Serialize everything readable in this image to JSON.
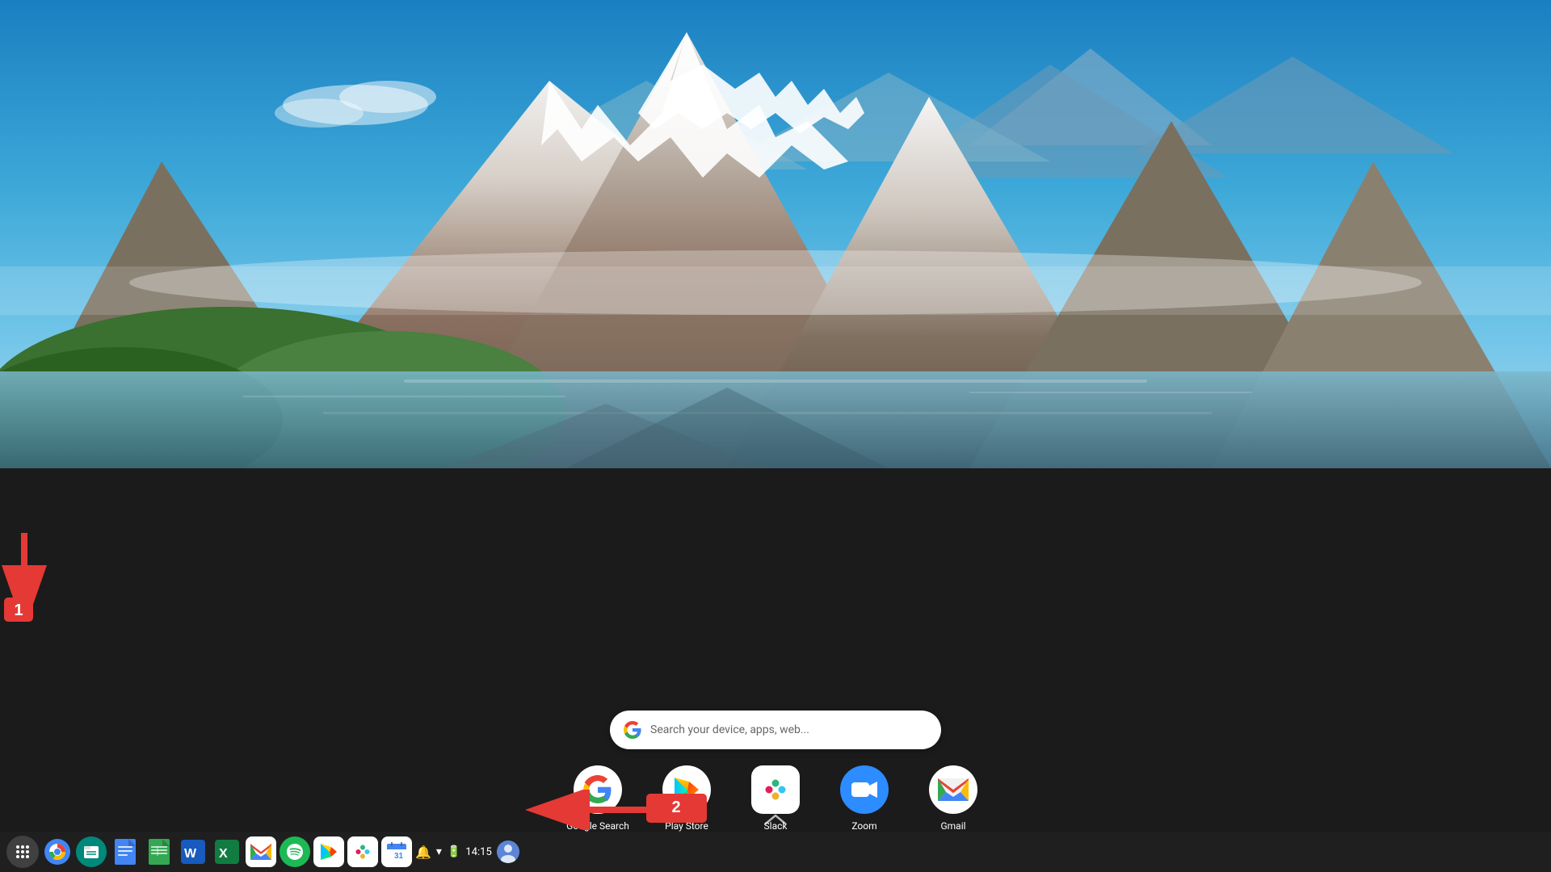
{
  "wallpaper": {
    "alt": "Mountain lake landscape with snow-capped peaks"
  },
  "search_bar": {
    "placeholder": "Search your device, apps, web...",
    "google_logo": "G"
  },
  "launcher_apps": [
    {
      "id": "google-search",
      "label": "Google Search",
      "icon_type": "google-g",
      "bg_color": "white"
    },
    {
      "id": "play-store",
      "label": "Play Store",
      "icon_type": "play-store",
      "bg_color": "white"
    },
    {
      "id": "slack",
      "label": "Slack",
      "icon_type": "slack",
      "bg_color": "white"
    },
    {
      "id": "zoom",
      "label": "Zoom",
      "icon_type": "zoom",
      "bg_color": "#2D8CFF"
    },
    {
      "id": "gmail",
      "label": "Gmail",
      "icon_type": "gmail",
      "bg_color": "white"
    }
  ],
  "shelf_apps": [
    {
      "id": "launcher",
      "icon": "⊙",
      "label": "Launcher"
    },
    {
      "id": "chrome",
      "icon": "",
      "label": "Chrome",
      "bg": "#4285F4"
    },
    {
      "id": "files",
      "icon": "",
      "label": "Files",
      "bg": "#00897B"
    },
    {
      "id": "docs",
      "icon": "",
      "label": "Docs",
      "bg": "#4285F4"
    },
    {
      "id": "sheets",
      "icon": "",
      "label": "Sheets",
      "bg": "#34A853"
    },
    {
      "id": "word",
      "icon": "",
      "label": "Word",
      "bg": "#185ABD"
    },
    {
      "id": "excel",
      "icon": "",
      "label": "Excel",
      "bg": "#107C41"
    },
    {
      "id": "gmail",
      "icon": "",
      "label": "Gmail",
      "bg": "white"
    },
    {
      "id": "spotify",
      "icon": "",
      "label": "Spotify",
      "bg": "#1DB954"
    },
    {
      "id": "play-store",
      "icon": "",
      "label": "Play Store",
      "bg": "white"
    },
    {
      "id": "slack2",
      "icon": "",
      "label": "Slack",
      "bg": "white"
    },
    {
      "id": "calendar",
      "icon": "",
      "label": "Calendar",
      "bg": "white"
    }
  ],
  "status_area": {
    "time": "14:15",
    "bell_icon": "🔔",
    "wifi_icon": "▾",
    "battery_icon": "🔋"
  },
  "annotations": {
    "arrow1_label": "1",
    "arrow2_label": "2"
  },
  "chevron": {
    "symbol": "∧"
  }
}
